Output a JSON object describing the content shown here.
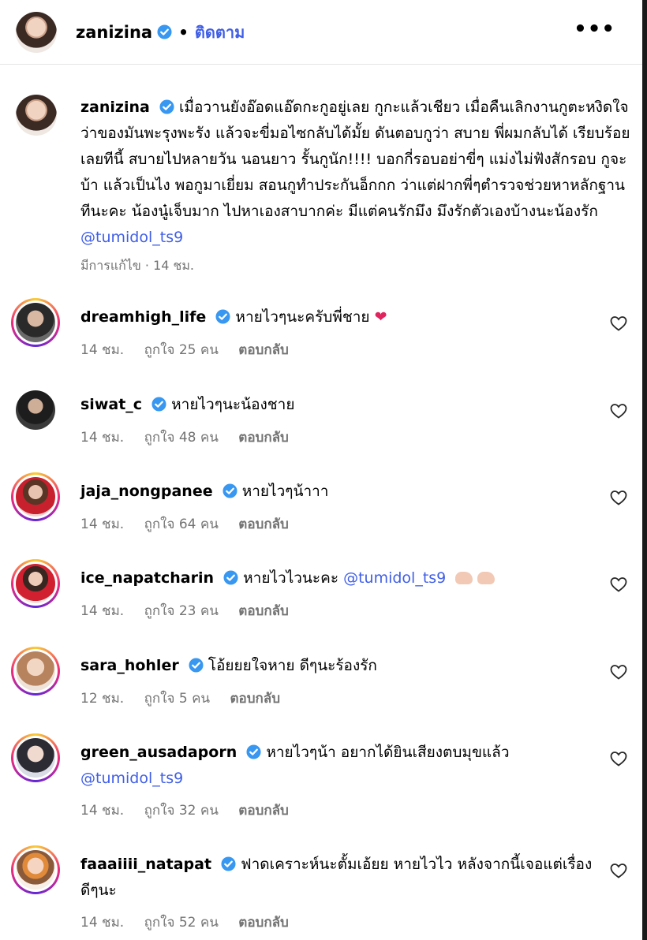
{
  "header": {
    "username": "zanizina",
    "separator": "•",
    "follow_label": "ติดตาม",
    "more_label": "•••"
  },
  "caption": {
    "username": "zanizina",
    "text": "เมื่อวานยังอ๊อดแอ๊ดกะกูอยู่เลย กูกะแล้วเชียว เมื่อคืนเลิกงานกูตะหงิดใจว่าของมันพะรุงพะรัง แล้วจะขี่มอไซกลับได้มั้ย ดันตอบกูว่า สบาย พี่ผมกลับได้ เรียบร้อยเลยทีนี้ สบายไปหลายวัน นอนยาว รั้นกูนัก!!!! บอกกี่รอบอย่าขี่ๆ แม่งไม่ฟังสักรอบ กูจะบ้า แล้วเป็นไง พอกูมาเยี่ยม สอนกูทำประกันอ็กกก ว่าแต่ฝากพี่ๆตำรวจช่วยหาหลักฐานทีนะคะ น้องนู๋เจ็บมาก ไปหาเองสาบากค่ะ มีแต่คนรักมึง มึงรักตัวเองบ้างนะน้องรัก",
    "mention": "@tumidol_ts9",
    "edited": "มีการแก้ไข",
    "time": "14 ชม."
  },
  "comments": [
    {
      "username": "dreamhigh_life",
      "verified": true,
      "text": "หายไวๆนะครับพี่ชาย",
      "mention": "",
      "emoji": "❤",
      "time": "14 ชม.",
      "likes": "ถูกใจ 25 คน",
      "reply": "ตอบกลับ"
    },
    {
      "username": "siwat_c",
      "verified": true,
      "text": "หายไวๆนะน้องชาย",
      "mention": "",
      "emoji": "",
      "time": "14 ชม.",
      "likes": "ถูกใจ 48 คน",
      "reply": "ตอบกลับ"
    },
    {
      "username": "jaja_nongpanee",
      "verified": true,
      "text": "หายไวๆน้าาา",
      "mention": "",
      "emoji": "",
      "time": "14 ชม.",
      "likes": "ถูกใจ 64 คน",
      "reply": "ตอบกลับ"
    },
    {
      "username": "ice_napatcharin",
      "verified": true,
      "text": "หายไวไวนะคะ",
      "mention": "@tumidol_ts9",
      "emoji": "",
      "time": "14 ชม.",
      "likes": "ถูกใจ 23 คน",
      "reply": "ตอบกลับ"
    },
    {
      "username": "sara_hohler",
      "verified": true,
      "text": "โอ้ยยยใจหาย ดีๆนะร้องรัก",
      "mention": "",
      "emoji": "",
      "time": "12 ชม.",
      "likes": "ถูกใจ 5 คน",
      "reply": "ตอบกลับ"
    },
    {
      "username": "green_ausadaporn",
      "verified": true,
      "text": "หายไวๆน้า อยากได้ยินเสียงตบมุขแล้ว",
      "mention": "@tumidol_ts9",
      "emoji": "",
      "time": "14 ชม.",
      "likes": "ถูกใจ 32 คน",
      "reply": "ตอบกลับ"
    },
    {
      "username": "faaaiiii_natapat",
      "verified": true,
      "text": "ฟาดเคราะห์นะตั้มเอ้ยย หายไวไว หลังจากนี้เจอแต่เรื่องดีๆนะ",
      "mention": "",
      "emoji": "",
      "time": "14 ชม.",
      "likes": "ถูกใจ 52 คน",
      "reply": "ตอบกลับ"
    }
  ],
  "colors": {
    "link": "#3f5ee6",
    "verified": "#3897f0",
    "meta": "#737373",
    "heart_emoji": "#e0245e"
  }
}
